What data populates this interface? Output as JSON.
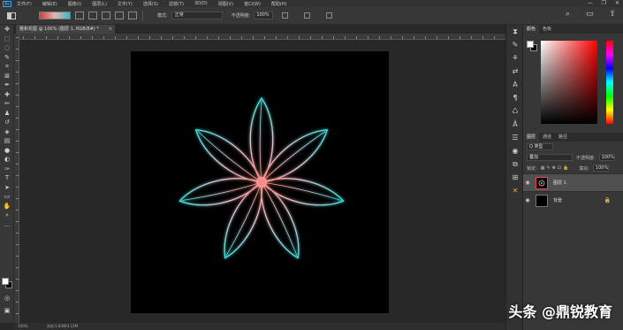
{
  "menubar": {
    "logo": "Ps",
    "items": [
      "文件(F)",
      "编辑(E)",
      "图像(I)",
      "图层(L)",
      "文字(Y)",
      "选择(S)",
      "滤镜(T)",
      "3D(D)",
      "视图(V)",
      "窗口(W)",
      "帮助(H)"
    ],
    "window_controls": [
      "—",
      "❐",
      "✕"
    ]
  },
  "options": {
    "mode_label": "模式:",
    "mode_value": "正常",
    "opacity_label": "不透明度:",
    "opacity_value": "100%"
  },
  "document": {
    "tab_label": "雅和花图 @ 100% (图层 1, RGB/8#) *",
    "close": "×"
  },
  "status": {
    "zoom": "100%",
    "doc_info": "文档:1.83M/3.12M"
  },
  "color_panel": {
    "tabs": [
      "颜色",
      "色板"
    ],
    "foreground": "#ffffff",
    "background": "#000000"
  },
  "layers_panel": {
    "tabs": [
      "图层",
      "通道",
      "路径"
    ],
    "kind_label": "Q 类型",
    "blend_mode": "叠加",
    "opacity_label": "不透明度:",
    "opacity_value": "100%",
    "lock_label": "锁定:",
    "fill_label": "填充:",
    "fill_value": "100%",
    "layers": [
      {
        "name": "图层 1",
        "selected": true
      },
      {
        "name": "背景",
        "selected": false
      }
    ]
  },
  "watermark": "头条 @鼎锐教育"
}
